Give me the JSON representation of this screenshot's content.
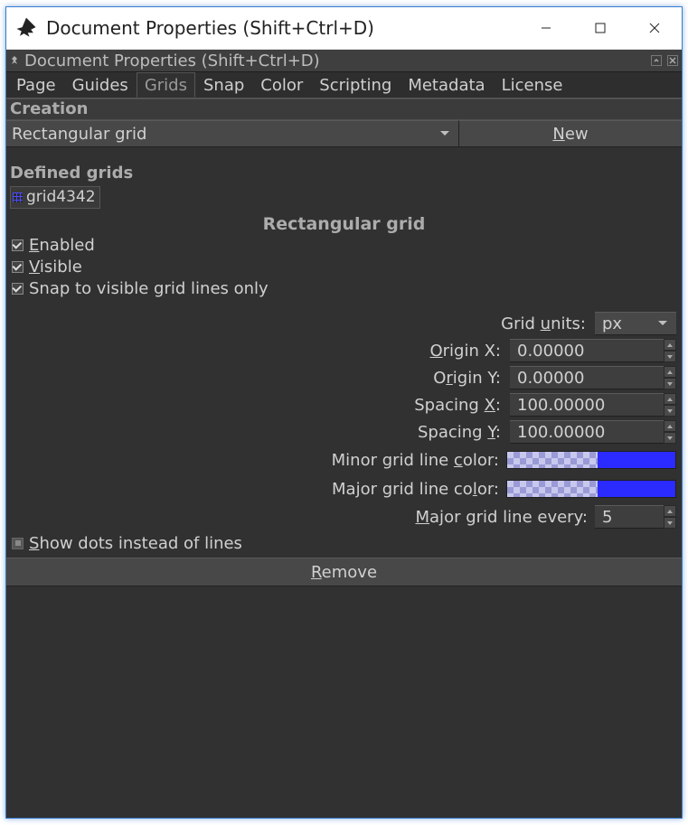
{
  "window": {
    "title": "Document Properties (Shift+Ctrl+D)"
  },
  "panel": {
    "title": "Document Properties (Shift+Ctrl+D)"
  },
  "tabs": [
    "Page",
    "Guides",
    "Grids",
    "Snap",
    "Color",
    "Scripting",
    "Metadata",
    "License"
  ],
  "active_tab": "Grids",
  "creation": {
    "header": "Creation",
    "grid_type": "Rectangular grid",
    "new_button": "New"
  },
  "defined": {
    "header": "Defined grids",
    "items": [
      "grid4342"
    ]
  },
  "grid": {
    "title": "Rectangular grid",
    "enabled_label": "Enabled",
    "visible_label": "Visible",
    "snap_visible_label": "Snap to visible grid lines only",
    "units_label": "Grid units:",
    "units_value": "px",
    "origin_x_label": "Origin X:",
    "origin_x_value": "0.00000",
    "origin_y_label": "Origin Y:",
    "origin_y_value": "0.00000",
    "spacing_x_label": "Spacing X:",
    "spacing_x_value": "100.00000",
    "spacing_y_label": "Spacing Y:",
    "spacing_y_value": "100.00000",
    "minor_color_label": "Minor grid line color:",
    "major_color_label": "Major grid line color:",
    "major_every_label": "Major grid line every:",
    "major_every_value": "5",
    "show_dots_label": "Show dots instead of lines",
    "remove_button": "Remove"
  }
}
